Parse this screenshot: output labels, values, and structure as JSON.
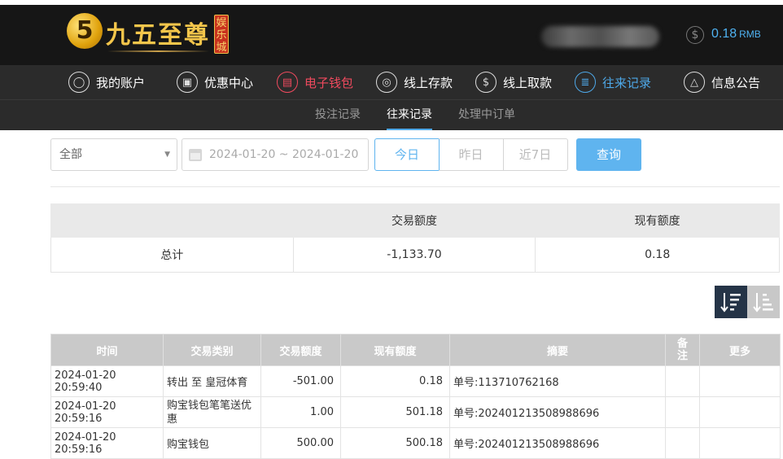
{
  "brand": {
    "mark": "5",
    "name": "九五至尊",
    "badge": "娱乐城"
  },
  "account": {
    "balance": "0.18",
    "currency": "RMB"
  },
  "nav": [
    {
      "label": "我的账户",
      "icon": "user-icon",
      "glyph": "◯"
    },
    {
      "label": "优惠中心",
      "icon": "gift-icon",
      "glyph": "▣"
    },
    {
      "label": "电子钱包",
      "icon": "wallet-icon",
      "glyph": "▤"
    },
    {
      "label": "线上存款",
      "icon": "deposit-icon",
      "glyph": "◎"
    },
    {
      "label": "线上取款",
      "icon": "withdraw-icon",
      "glyph": "$"
    },
    {
      "label": "往来记录",
      "icon": "record-icon",
      "glyph": "≣"
    },
    {
      "label": "信息公告",
      "icon": "bell-icon",
      "glyph": "△"
    }
  ],
  "subnav": [
    "投注记录",
    "往来记录",
    "处理中订单"
  ],
  "filters": {
    "type_value": "全部",
    "date_range": "2024-01-20 ~ 2024-01-20",
    "quick": [
      "今日",
      "昨日",
      "近7日"
    ],
    "query": "查询"
  },
  "summary": {
    "headers": [
      "",
      "交易额度",
      "现有额度"
    ],
    "row": [
      "总计",
      "-1,133.70",
      "0.18"
    ]
  },
  "records": {
    "headers": [
      "时间",
      "交易类别",
      "交易额度",
      "现有额度",
      "摘要",
      "备注",
      "更多"
    ],
    "rows": [
      [
        "2024-01-20 20:59:40",
        "转出 至 皇冠体育",
        "-501.00",
        "0.18",
        "单号:113710762168",
        "",
        ""
      ],
      [
        "2024-01-20 20:59:16",
        "购宝钱包笔笔送优惠",
        "1.00",
        "501.18",
        "单号:202401213508988696",
        "",
        ""
      ],
      [
        "2024-01-20 20:59:16",
        "购宝钱包",
        "500.00",
        "500.18",
        "单号:202401213508988696",
        "",
        ""
      ]
    ]
  },
  "colors": {
    "accent": "#4ea8e8",
    "active_red": "#f04a5e",
    "header_bg": "#161616",
    "nav_bg": "#2b2b2b"
  }
}
